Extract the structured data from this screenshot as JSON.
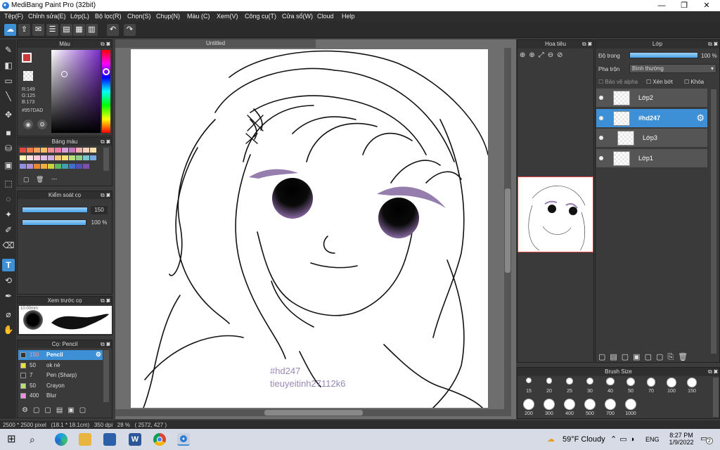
{
  "window": {
    "title": "MediBang Paint Pro (32bit)",
    "minimize": "—",
    "restore": "❐",
    "close": "✕"
  },
  "menu": [
    "Tệp(F)",
    "Chỉnh sửa(E)",
    "Lớp(L)",
    "Bộ lọc(R)",
    "Chọn(S)",
    "Chụp(N)",
    "Màu (C)",
    "Xem(V)",
    "Công cụ(T)",
    "Cửa sổ(W)",
    "Cloud",
    "Help"
  ],
  "color_panel": {
    "title": "Màu",
    "r": "R:149",
    "g": "G:125",
    "b": "B:173",
    "hex": "#957DAD",
    "current_color": "#cc3a3a"
  },
  "palette_panel": {
    "title": "Bảng màu",
    "placeholder": "---",
    "swatches": [
      "#e8483b",
      "#f07a4a",
      "#f4a05e",
      "#f6c06a",
      "#ee8f8f",
      "#e87aa6",
      "#d8a0d8",
      "#c878c0",
      "#f2b0b0",
      "#f8d0c0",
      "#f5e0a8",
      "#fff3b0",
      "#fde2e2",
      "#f8c8d8",
      "#e0c0e8",
      "#d0b0e0",
      "#f0c878",
      "#f8e078",
      "#b8e078",
      "#8fd08f",
      "#78c8d0",
      "#78a8e0",
      "#9090e0",
      "#b090d8",
      "#e88830",
      "#f0b040",
      "#d0d040",
      "#60b860",
      "#40a0b0",
      "#4070c8",
      "#5050b8",
      "#8050a8"
    ]
  },
  "brush_control": {
    "title": "Kiểm soát cọ",
    "size": "150",
    "opacity": "100 %"
  },
  "brush_preview": {
    "title": "Xem trước cọ",
    "size_label": "10.00mm"
  },
  "brush_list": {
    "title": "Cọ: Pencil",
    "items": [
      {
        "size": "150",
        "name": "Pencil",
        "color": "#333333"
      },
      {
        "size": "50",
        "name": "ok nè",
        "color": "#e8e040"
      },
      {
        "size": "7",
        "name": "Pen (Sharp)",
        "color": "#333333"
      },
      {
        "size": "50",
        "name": "Crayon",
        "color": "#b8e070"
      },
      {
        "size": "400",
        "name": "Blur",
        "color": "#f090e0"
      }
    ]
  },
  "canvas": {
    "tab": "Untitled",
    "watermark_line1": "#hd247",
    "watermark_line2": "tieuyeitinh27112k6"
  },
  "navigator": {
    "title": "Hoa tiêu"
  },
  "layers_panel": {
    "title": "Lớp",
    "opacity_label": "Độ trong",
    "opacity_value": "100 %",
    "blend_label": "Pha trộn",
    "blend_value": "Bình thường",
    "protect_alpha": "Bảo vệ alpha",
    "clipping": "Xén bớt",
    "lock": "Khóa",
    "layers": [
      {
        "name": "Lớp2",
        "selected": false,
        "indent": false
      },
      {
        "name": "#hd247",
        "selected": true,
        "indent": false
      },
      {
        "name": "Lớp3",
        "selected": false,
        "indent": true
      },
      {
        "name": "Lớp1",
        "selected": false,
        "indent": false
      }
    ]
  },
  "brush_size_panel": {
    "title": "Brush Size",
    "sizes_row1": [
      "15",
      "20",
      "25",
      "30",
      "40",
      "50",
      "70",
      "100",
      "150"
    ],
    "sizes_row2": [
      "200",
      "300",
      "400",
      "500",
      "700",
      "1000"
    ]
  },
  "status_bar": {
    "info": "2500 * 2500 pixel   (18.1 * 18.1cm)   350 dpi   28 %   ( 2572, 427 )"
  },
  "taskbar": {
    "weather": "59°F  Cloudy",
    "lang": "ENG",
    "time": "8:27 PM",
    "date": "1/9/2022",
    "notifications": "2"
  },
  "colors": {
    "accent": "#3d8fd6",
    "panel_bg": "#3a3a3a",
    "eyeshadow": "#957DAD"
  }
}
